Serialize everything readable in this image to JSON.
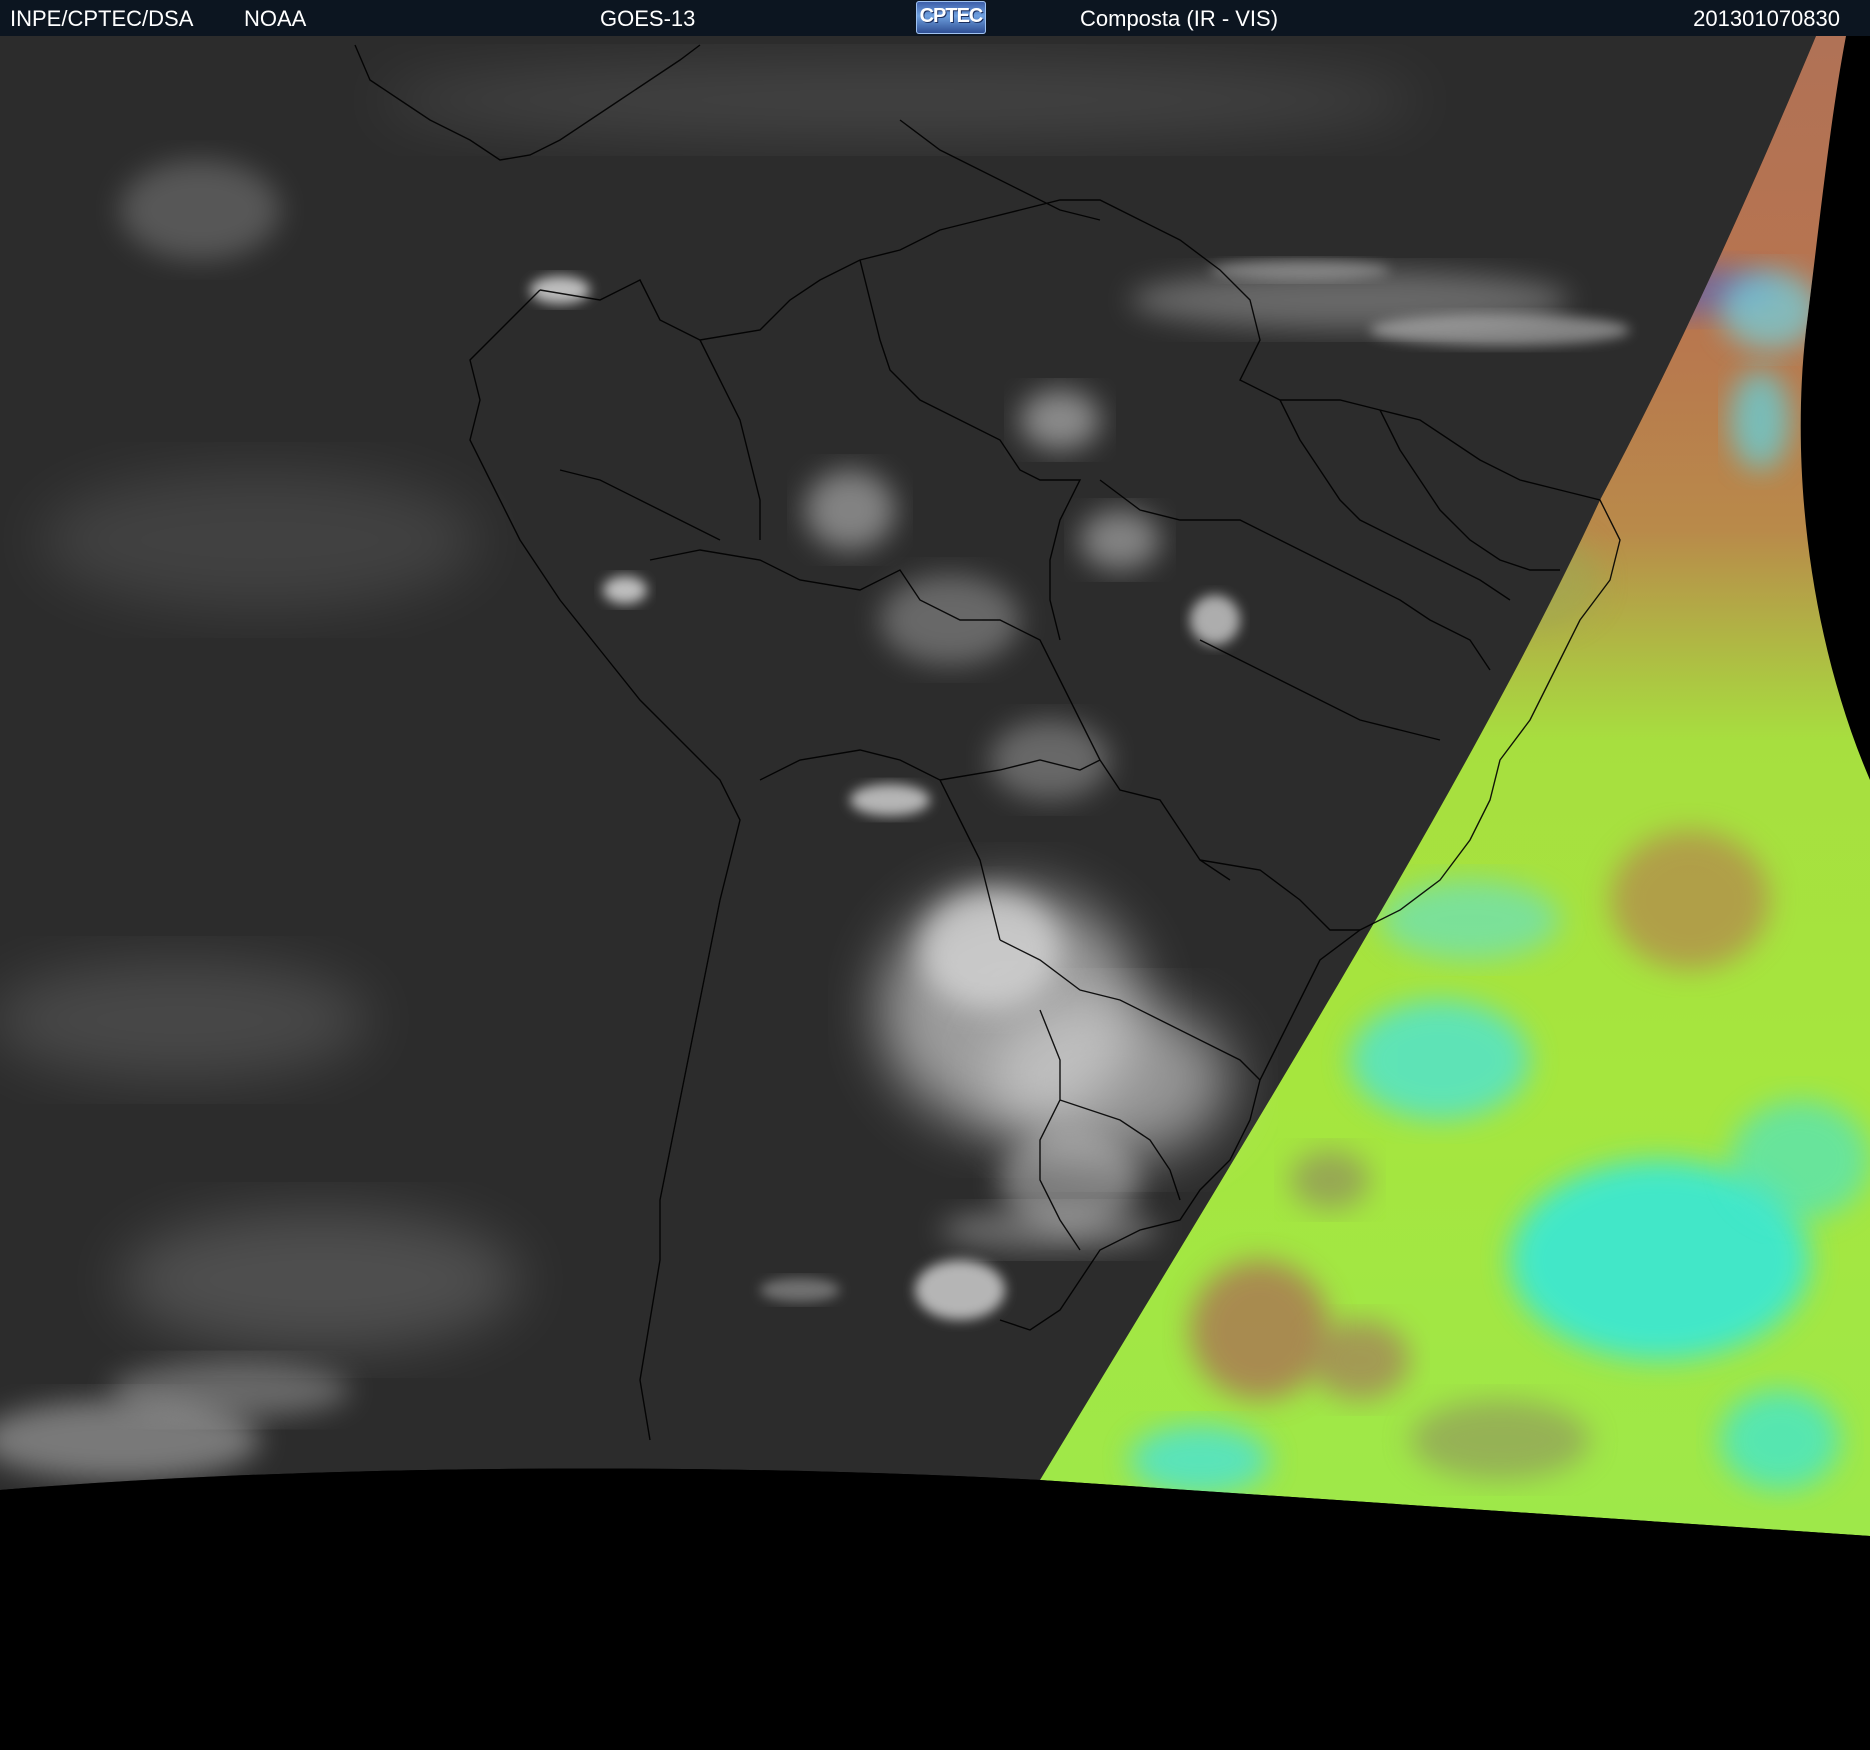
{
  "header": {
    "organization": "INPE/CPTEC/DSA",
    "agency": "NOAA",
    "satellite": "GOES-13",
    "logo_text": "CPTEC",
    "product": "Composta (IR - VIS)",
    "timestamp": "201301070830"
  },
  "colors": {
    "header_bg": "#0c1520",
    "header_text": "#ffffff",
    "ir_background": "#2c2c2c",
    "cloud": "#d8d8d8",
    "vis_land": "#b4765a",
    "vis_ocean_green": "#a6e63e",
    "vis_ocean_cyan": "#33e6dc",
    "outside_disk": "#000000",
    "borders": "#000000"
  }
}
